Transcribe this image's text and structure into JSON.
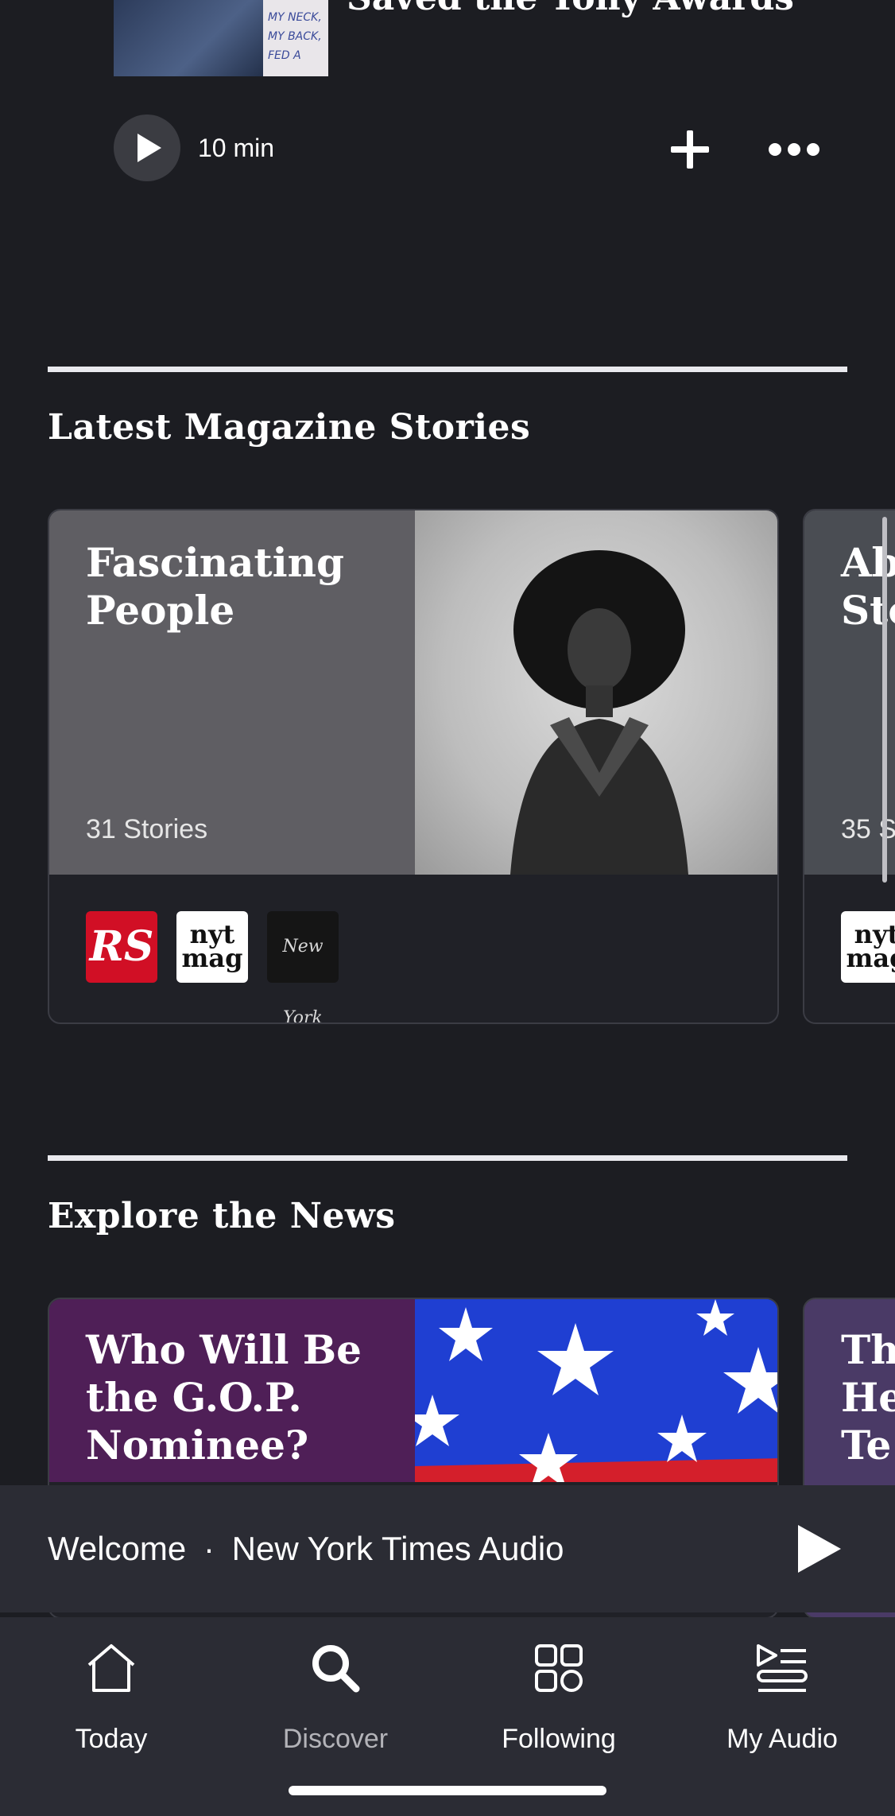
{
  "top_item": {
    "title": "Saved the Tony Awards",
    "duration": "10 min",
    "thumbnail_sign_text": "MY NECK, MY BACK, FED A"
  },
  "sections": [
    {
      "title": "Latest Magazine Stories",
      "cards": [
        {
          "title_line1": "Fascinating",
          "title_line2": "People",
          "count": "31 Stories",
          "logos": [
            {
              "name": "rolling-stone-logo",
              "text": "RS",
              "bg": "#d10f25"
            },
            {
              "name": "nyt-mag-logo",
              "text_line1": "nyt",
              "text_line2": "mag",
              "bg": "#ffffff"
            },
            {
              "name": "new-york-mag-logo",
              "text": "New York",
              "bg": "#151515"
            }
          ]
        },
        {
          "title_line1": "Ab",
          "title_line2": "Sto",
          "count": "35 S",
          "logo_line1": "nyt",
          "logo_line2": "mag"
        }
      ]
    },
    {
      "title": "Explore the News",
      "cards": [
        {
          "title_line1": "Who Will Be",
          "title_line2": "the G.O.P.",
          "title_line3": "Nominee?",
          "bg": "#4f1f57"
        },
        {
          "title_line1": "Th",
          "title_line2": "He",
          "title_line3": "Te",
          "bg": "#4a3a66"
        }
      ]
    }
  ],
  "mini_player": {
    "show": "Welcome",
    "separator": "·",
    "publisher": "New York Times Audio"
  },
  "tabs": [
    {
      "label": "Today",
      "icon": "home-icon",
      "active": true
    },
    {
      "label": "Discover",
      "icon": "search-icon",
      "active": false
    },
    {
      "label": "Following",
      "icon": "grid-icon",
      "active": true
    },
    {
      "label": "My Audio",
      "icon": "playlist-icon",
      "active": true
    }
  ],
  "colors": {
    "background": "#1c1d22",
    "player_bar": "#2b2c34",
    "card_border": "#3b3c44"
  }
}
